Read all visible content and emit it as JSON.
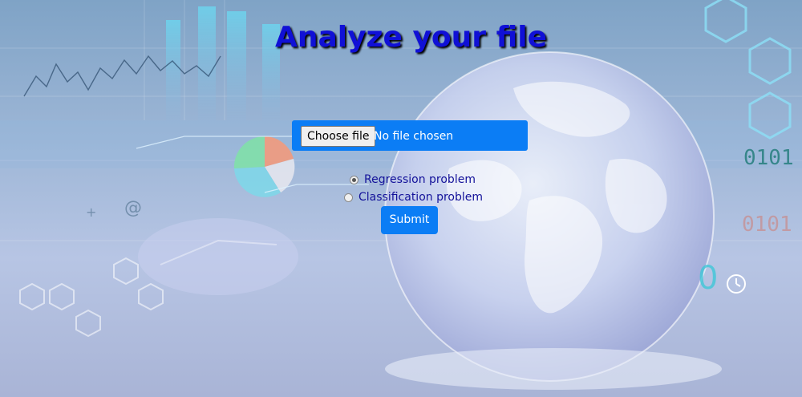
{
  "page": {
    "title": "Analyze your file"
  },
  "form": {
    "file_button_label": "Choose file",
    "file_status": "No file chosen",
    "options": [
      {
        "label": "Regression problem",
        "checked": true
      },
      {
        "label": "Classification problem",
        "checked": false
      }
    ],
    "submit_label": "Submit"
  },
  "background": {
    "digits": [
      "0101",
      "0101"
    ],
    "at_symbol": "@",
    "plus_symbol": "+"
  }
}
